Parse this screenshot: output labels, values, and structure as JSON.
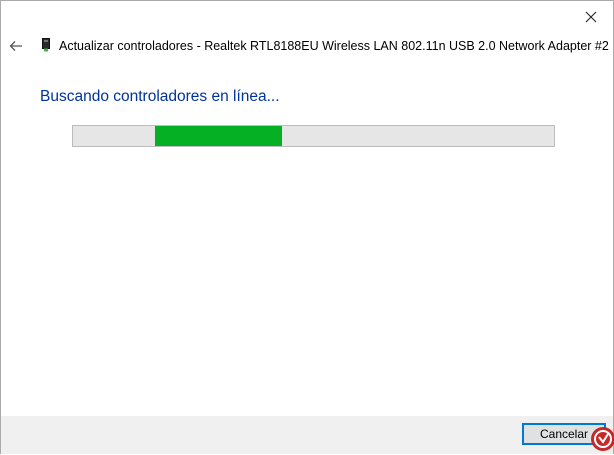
{
  "dialog": {
    "title": "Actualizar controladores - Realtek RTL8188EU Wireless LAN 802.11n USB 2.0 Network Adapter #2",
    "status": "Buscando controladores en línea...",
    "progress": {
      "indeterminate": true,
      "chunk_color": "#06b025"
    },
    "cancel_label": "Cancelar"
  },
  "icons": {
    "close": "close-icon",
    "back": "back-arrow-icon",
    "device": "network-adapter-icon"
  },
  "colors": {
    "status_text": "#003399",
    "progress_fill": "#06b025",
    "button_focus_border": "#0078d7"
  }
}
